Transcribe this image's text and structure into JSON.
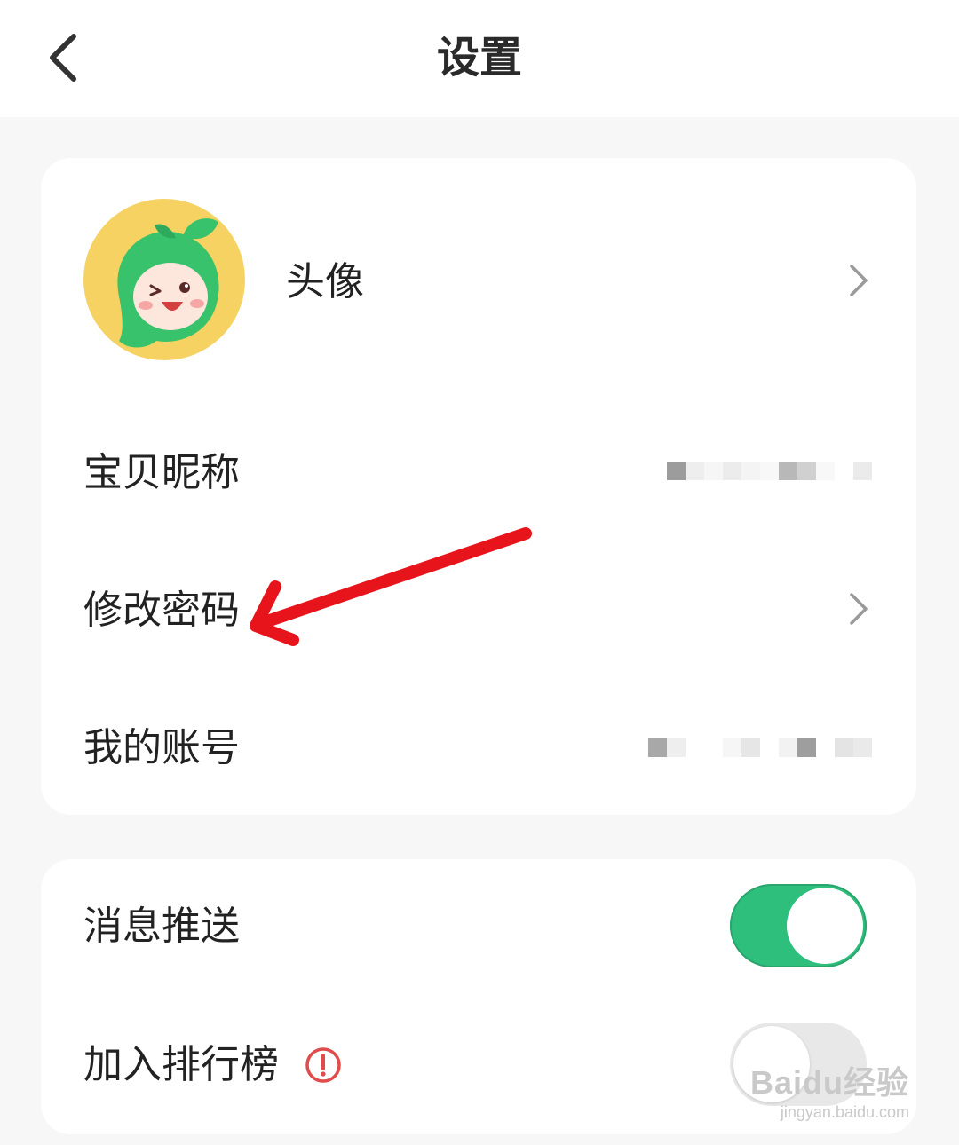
{
  "header": {
    "title": "设置",
    "back_icon": "chevron-left-icon"
  },
  "profile_card": {
    "avatar": {
      "label": "头像",
      "icon": "mascot-avatar"
    },
    "nickname": {
      "label": "宝贝昵称",
      "value_state": "masked"
    },
    "change_password": {
      "label": "修改密码"
    },
    "my_account": {
      "label": "我的账号",
      "value_state": "masked"
    }
  },
  "settings_card": {
    "push": {
      "label": "消息推送",
      "enabled": true
    },
    "leaderboard": {
      "label": "加入排行榜",
      "enabled": false,
      "info_icon": "exclamation-circle-icon"
    }
  },
  "colors": {
    "accent": "#2fbf7d",
    "annotation": "#e8141c",
    "warning": "#e04b4b",
    "background": "#f7f7f7"
  },
  "watermark": {
    "logo": "Baidu经验",
    "url": "jingyan.baidu.com"
  }
}
